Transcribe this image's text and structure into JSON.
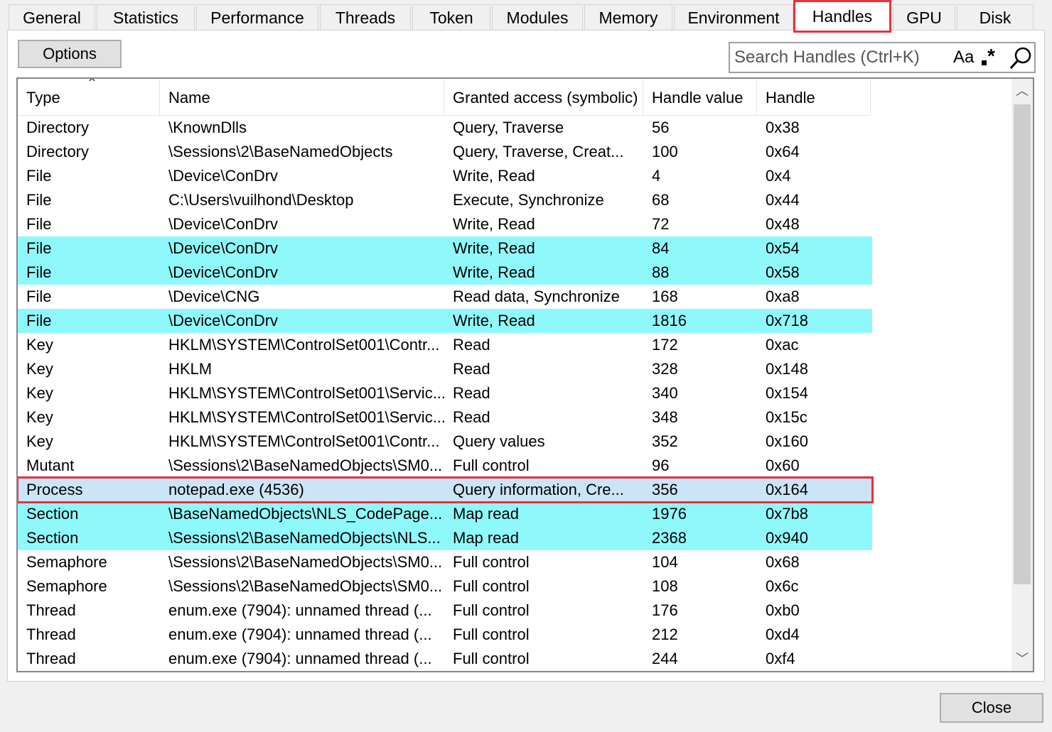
{
  "tabs": [
    {
      "label": "General"
    },
    {
      "label": "Statistics"
    },
    {
      "label": "Performance"
    },
    {
      "label": "Threads"
    },
    {
      "label": "Token"
    },
    {
      "label": "Modules"
    },
    {
      "label": "Memory"
    },
    {
      "label": "Environment"
    },
    {
      "label": "Handles",
      "active": true
    },
    {
      "label": "GPU"
    },
    {
      "label": "Disk"
    }
  ],
  "toolbar": {
    "options_label": "Options",
    "search_placeholder": "Search Handles (Ctrl+K)",
    "case_label": "Aa",
    "regex_label": "*"
  },
  "columns": [
    "Type",
    "Name",
    "Granted access (symbolic)",
    "Handle value",
    "Handle"
  ],
  "rows": [
    {
      "type": "Directory",
      "name": "\\KnownDlls",
      "access": "Query, Traverse",
      "value": "56",
      "handle": "0x38"
    },
    {
      "type": "Directory",
      "name": "\\Sessions\\2\\BaseNamedObjects",
      "access": "Query, Traverse, Creat...",
      "value": "100",
      "handle": "0x64"
    },
    {
      "type": "File",
      "name": "\\Device\\ConDrv",
      "access": "Write, Read",
      "value": "4",
      "handle": "0x4"
    },
    {
      "type": "File",
      "name": "C:\\Users\\vuilhond\\Desktop",
      "access": "Execute, Synchronize",
      "value": "68",
      "handle": "0x44"
    },
    {
      "type": "File",
      "name": "\\Device\\ConDrv",
      "access": "Write, Read",
      "value": "72",
      "handle": "0x48"
    },
    {
      "type": "File",
      "name": "\\Device\\ConDrv",
      "access": "Write, Read",
      "value": "84",
      "handle": "0x54",
      "highlight": true
    },
    {
      "type": "File",
      "name": "\\Device\\ConDrv",
      "access": "Write, Read",
      "value": "88",
      "handle": "0x58",
      "highlight": true
    },
    {
      "type": "File",
      "name": "\\Device\\CNG",
      "access": "Read data, Synchronize",
      "value": "168",
      "handle": "0xa8"
    },
    {
      "type": "File",
      "name": "\\Device\\ConDrv",
      "access": "Write, Read",
      "value": "1816",
      "handle": "0x718",
      "highlight": true
    },
    {
      "type": "Key",
      "name": "HKLM\\SYSTEM\\ControlSet001\\Contr...",
      "access": "Read",
      "value": "172",
      "handle": "0xac"
    },
    {
      "type": "Key",
      "name": "HKLM",
      "access": "Read",
      "value": "328",
      "handle": "0x148"
    },
    {
      "type": "Key",
      "name": "HKLM\\SYSTEM\\ControlSet001\\Servic...",
      "access": "Read",
      "value": "340",
      "handle": "0x154"
    },
    {
      "type": "Key",
      "name": "HKLM\\SYSTEM\\ControlSet001\\Servic...",
      "access": "Read",
      "value": "348",
      "handle": "0x15c"
    },
    {
      "type": "Key",
      "name": "HKLM\\SYSTEM\\ControlSet001\\Contr...",
      "access": "Query values",
      "value": "352",
      "handle": "0x160"
    },
    {
      "type": "Mutant",
      "name": "\\Sessions\\2\\BaseNamedObjects\\SM0...",
      "access": "Full control",
      "value": "96",
      "handle": "0x60"
    },
    {
      "type": "Process",
      "name": "notepad.exe (4536)",
      "access": "Query information, Cre...",
      "value": "356",
      "handle": "0x164",
      "selected": true
    },
    {
      "type": "Section",
      "name": "\\BaseNamedObjects\\NLS_CodePage...",
      "access": "Map read",
      "value": "1976",
      "handle": "0x7b8",
      "highlight": true
    },
    {
      "type": "Section",
      "name": "\\Sessions\\2\\BaseNamedObjects\\NLS...",
      "access": "Map read",
      "value": "2368",
      "handle": "0x940",
      "highlight": true
    },
    {
      "type": "Semaphore",
      "name": "\\Sessions\\2\\BaseNamedObjects\\SM0...",
      "access": "Full control",
      "value": "104",
      "handle": "0x68"
    },
    {
      "type": "Semaphore",
      "name": "\\Sessions\\2\\BaseNamedObjects\\SM0...",
      "access": "Full control",
      "value": "108",
      "handle": "0x6c"
    },
    {
      "type": "Thread",
      "name": "enum.exe (7904): unnamed thread (...",
      "access": "Full control",
      "value": "176",
      "handle": "0xb0"
    },
    {
      "type": "Thread",
      "name": "enum.exe (7904): unnamed thread (...",
      "access": "Full control",
      "value": "212",
      "handle": "0xd4"
    },
    {
      "type": "Thread",
      "name": "enum.exe (7904): unnamed thread (...",
      "access": "Full control",
      "value": "244",
      "handle": "0xf4"
    }
  ],
  "footer": {
    "close_label": "Close"
  },
  "colors": {
    "highlight": "#8ff8fb",
    "selected": "#cce4f7",
    "annotation": "#e5323b"
  }
}
